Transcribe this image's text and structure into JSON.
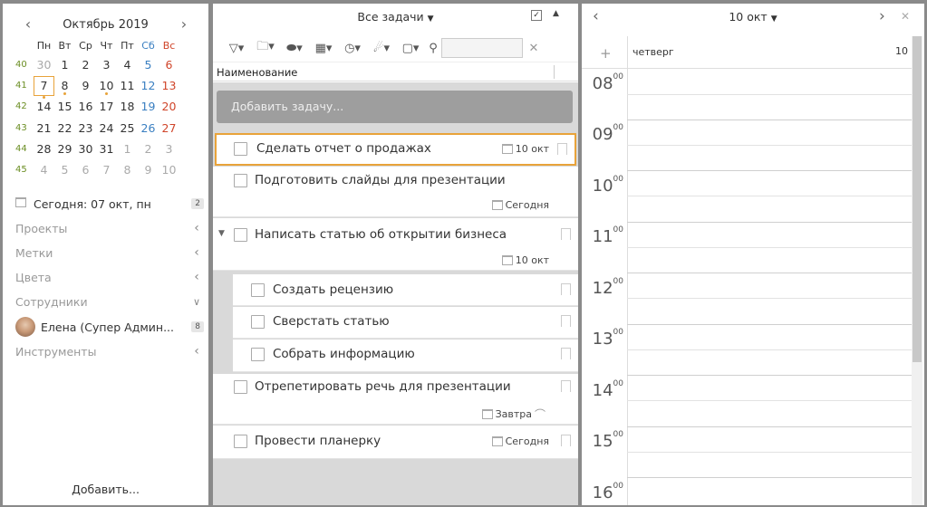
{
  "calendar": {
    "month_title": "Октябрь 2019",
    "weekdays": [
      "Пн",
      "Вт",
      "Ср",
      "Чт",
      "Пт",
      "Сб",
      "Вс"
    ],
    "weeks": [
      {
        "num": "40",
        "days": [
          "30",
          "1",
          "2",
          "3",
          "4",
          "5",
          "6"
        ]
      },
      {
        "num": "41",
        "days": [
          "7",
          "8",
          "9",
          "10",
          "11",
          "12",
          "13"
        ]
      },
      {
        "num": "42",
        "days": [
          "14",
          "15",
          "16",
          "17",
          "18",
          "19",
          "20"
        ]
      },
      {
        "num": "43",
        "days": [
          "21",
          "22",
          "23",
          "24",
          "25",
          "26",
          "27"
        ]
      },
      {
        "num": "44",
        "days": [
          "28",
          "29",
          "30",
          "31",
          "1",
          "2",
          "3"
        ]
      },
      {
        "num": "45",
        "days": [
          "4",
          "5",
          "6",
          "7",
          "8",
          "9",
          "10"
        ]
      }
    ]
  },
  "sidebar": {
    "today_label": "Сегодня: 07 окт, пн",
    "today_count": "2",
    "sections": [
      {
        "label": "Проекты",
        "chevron": "<"
      },
      {
        "label": "Метки",
        "chevron": "<"
      },
      {
        "label": "Цвета",
        "chevron": "<"
      },
      {
        "label": "Сотрудники",
        "chevron": "v"
      }
    ],
    "user_name": "Елена (Супер Админ...",
    "user_count": "8",
    "tools_label": "Инструменты",
    "add_label": "Добавить..."
  },
  "tasks": {
    "filter_title": "Все задачи",
    "column_header": "Наименование",
    "add_placeholder": "Добавить задачу...",
    "items": [
      {
        "title": "Сделать отчет о продажах",
        "due": "10 окт"
      },
      {
        "title": "Подготовить слайды для презентации",
        "due": "Сегодня"
      },
      {
        "title": "Написать статью об открытии бизнеса",
        "due": "10 окт"
      },
      {
        "title": "Создать рецензию",
        "due": ""
      },
      {
        "title": "Сверстать статью",
        "due": ""
      },
      {
        "title": "Собрать информацию",
        "due": ""
      },
      {
        "title": "Отрепетировать речь для презентации",
        "due": "Завтра"
      },
      {
        "title": "Провести планерку",
        "due": "Сегодня"
      }
    ]
  },
  "dayview": {
    "date_title": "10 окт",
    "day_name": "четверг",
    "day_number": "10",
    "plus": "+",
    "hours": [
      {
        "h": "08",
        "m": "00"
      },
      {
        "h": "09",
        "m": "00"
      },
      {
        "h": "10",
        "m": "00"
      },
      {
        "h": "11",
        "m": "00"
      },
      {
        "h": "12",
        "m": "00"
      },
      {
        "h": "13",
        "m": "00"
      },
      {
        "h": "14",
        "m": "00"
      },
      {
        "h": "15",
        "m": "00"
      },
      {
        "h": "16",
        "m": "00"
      }
    ]
  },
  "colors": {
    "accent": "#e8a33a",
    "weekend_sat": "#3a7fc1",
    "weekend_sun": "#d0452a"
  }
}
